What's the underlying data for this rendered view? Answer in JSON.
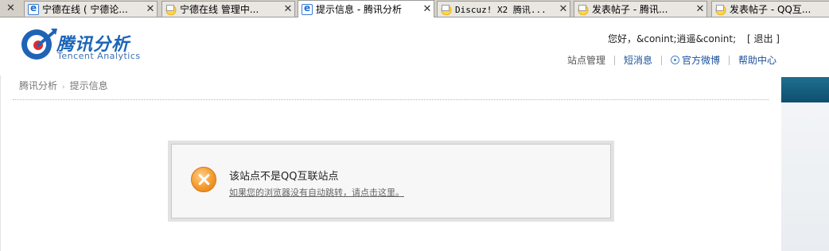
{
  "tabs": [
    {
      "label": "宁德在线 ( 宁德论...",
      "icon": "ie-page-icon",
      "active": false
    },
    {
      "label": "宁德在线 管理中...",
      "icon": "qq-browser-icon",
      "active": false
    },
    {
      "label": "提示信息 - 腾讯分析",
      "icon": "ie-page-icon",
      "active": true
    },
    {
      "label": "Discuz! X2 腾讯...",
      "icon": "qq-browser-icon",
      "active": false
    },
    {
      "label": "发表帖子 - 腾讯...",
      "icon": "qq-browser-icon",
      "active": false
    },
    {
      "label": "发表帖子 - QQ互...",
      "icon": "qq-browser-icon",
      "active": false
    }
  ],
  "header": {
    "logo_cn": "腾讯分析",
    "logo_en": "Tencent Analytics",
    "greeting": "您好，&conint;逍遥&conint;",
    "logout": "[ 退出 ]",
    "nav": {
      "site_manage": "站点管理",
      "messages": "短消息",
      "weibo": "官方微博",
      "help": "帮助中心"
    }
  },
  "breadcrumb": {
    "home": "腾讯分析",
    "current": "提示信息"
  },
  "message": {
    "title": "该站点不是QQ互联站点",
    "redirect_link": "如果您的浏览器没有自动跳转，请点击这里。"
  },
  "colors": {
    "brand": "#1a64b8",
    "error_icon": "#f49a2c",
    "accent_strip": "#0e4e70"
  }
}
